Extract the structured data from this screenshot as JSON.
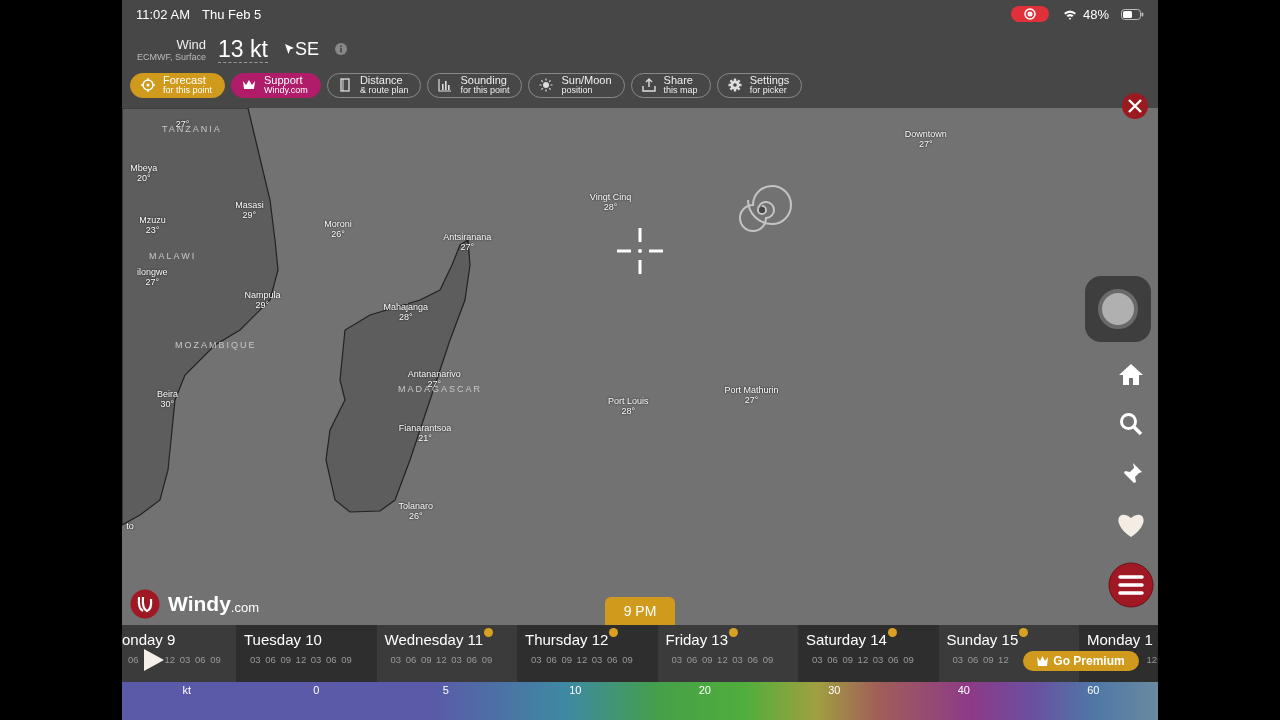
{
  "status_bar": {
    "time": "11:02 AM",
    "date": "Thu Feb 5",
    "battery": "48%"
  },
  "picker": {
    "label": "Wind",
    "source": "ECMWF, Surface",
    "value": "13 kt",
    "direction": "SE"
  },
  "actions": [
    {
      "kind": "forecast",
      "title": "Forecast",
      "subtitle": "for this point"
    },
    {
      "kind": "support",
      "title": "Support",
      "subtitle": "Windy.com"
    },
    {
      "kind": "distance",
      "title": "Distance",
      "subtitle": "& route plan"
    },
    {
      "kind": "sounding",
      "title": "Sounding",
      "subtitle": "for this point"
    },
    {
      "kind": "sunmoon",
      "title": "Sun/Moon",
      "subtitle": "position"
    },
    {
      "kind": "share",
      "title": "Share",
      "subtitle": "this map"
    },
    {
      "kind": "settings",
      "title": "Settings",
      "subtitle": "for picker"
    }
  ],
  "map": {
    "places": [
      {
        "kind": "city",
        "temp": "27°"
      },
      {
        "kind": "country",
        "name": "TANZANIA"
      },
      {
        "kind": "city",
        "name": "Mbeya",
        "temp": "20°"
      },
      {
        "kind": "city",
        "name": "Masasi",
        "temp": "29°"
      },
      {
        "kind": "city",
        "name": "Mzuzu",
        "temp": "23°"
      },
      {
        "kind": "city",
        "name": "Moroni",
        "temp": "26°"
      },
      {
        "kind": "city",
        "name": "Antsiranana",
        "temp": "27°"
      },
      {
        "kind": "city",
        "name": "Vingt Cinq",
        "temp": "28°"
      },
      {
        "kind": "city",
        "name": "Downtown",
        "temp": "27°"
      },
      {
        "kind": "country",
        "name": "MALAWI"
      },
      {
        "kind": "city",
        "name": "ilongwe",
        "temp": "27°"
      },
      {
        "kind": "city",
        "name": "Nampula",
        "temp": "29°"
      },
      {
        "kind": "city",
        "name": "Mahajanga",
        "temp": "28°"
      },
      {
        "kind": "country",
        "name": "MOZAMBIQUE"
      },
      {
        "kind": "city",
        "name": "Antananarivo",
        "temp": "27°"
      },
      {
        "kind": "country",
        "name": "MADAGASCAR"
      },
      {
        "kind": "city",
        "name": "Port Mathurin",
        "temp": "27°"
      },
      {
        "kind": "city",
        "name": "Port Louis",
        "temp": "28°"
      },
      {
        "kind": "city",
        "name": "Beira",
        "temp": "30°"
      },
      {
        "kind": "city",
        "name": "Fianarantsoa",
        "temp": "21°"
      },
      {
        "kind": "city",
        "name": "Tolanaro",
        "temp": "26°"
      },
      {
        "kind": "city",
        "name": "to"
      }
    ],
    "logo_name": "Windy",
    "logo_domain": ".com"
  },
  "timeline": {
    "current_time": "9 PM",
    "days": [
      {
        "label": "onday 9",
        "hours_lead": "06",
        "hours": "12 03 06 09",
        "premium": false
      },
      {
        "label": "Tuesday 10",
        "hours": "03 06 09 12 03 06 09",
        "premium": false
      },
      {
        "label": "Wednesday 11",
        "hours": "03 06 09 12 03 06 09",
        "premium": true
      },
      {
        "label": "Thursday 12",
        "hours": "03 06 09 12 03 06 09",
        "premium": true
      },
      {
        "label": "Friday 13",
        "hours": "03 06 09 12 03 06 09",
        "premium": true
      },
      {
        "label": "Saturday 14",
        "hours": "03 06 09 12 03 06 09",
        "premium": true
      },
      {
        "label": "Sunday 15",
        "hours": "03 06 09 12",
        "premium": true
      },
      {
        "label": "Monday 1",
        "hours": "12",
        "premium": false
      }
    ],
    "go_premium": "Go Premium"
  },
  "legend": {
    "unit": "kt",
    "ticks": [
      "0",
      "5",
      "10",
      "20",
      "30",
      "40",
      "60"
    ]
  }
}
